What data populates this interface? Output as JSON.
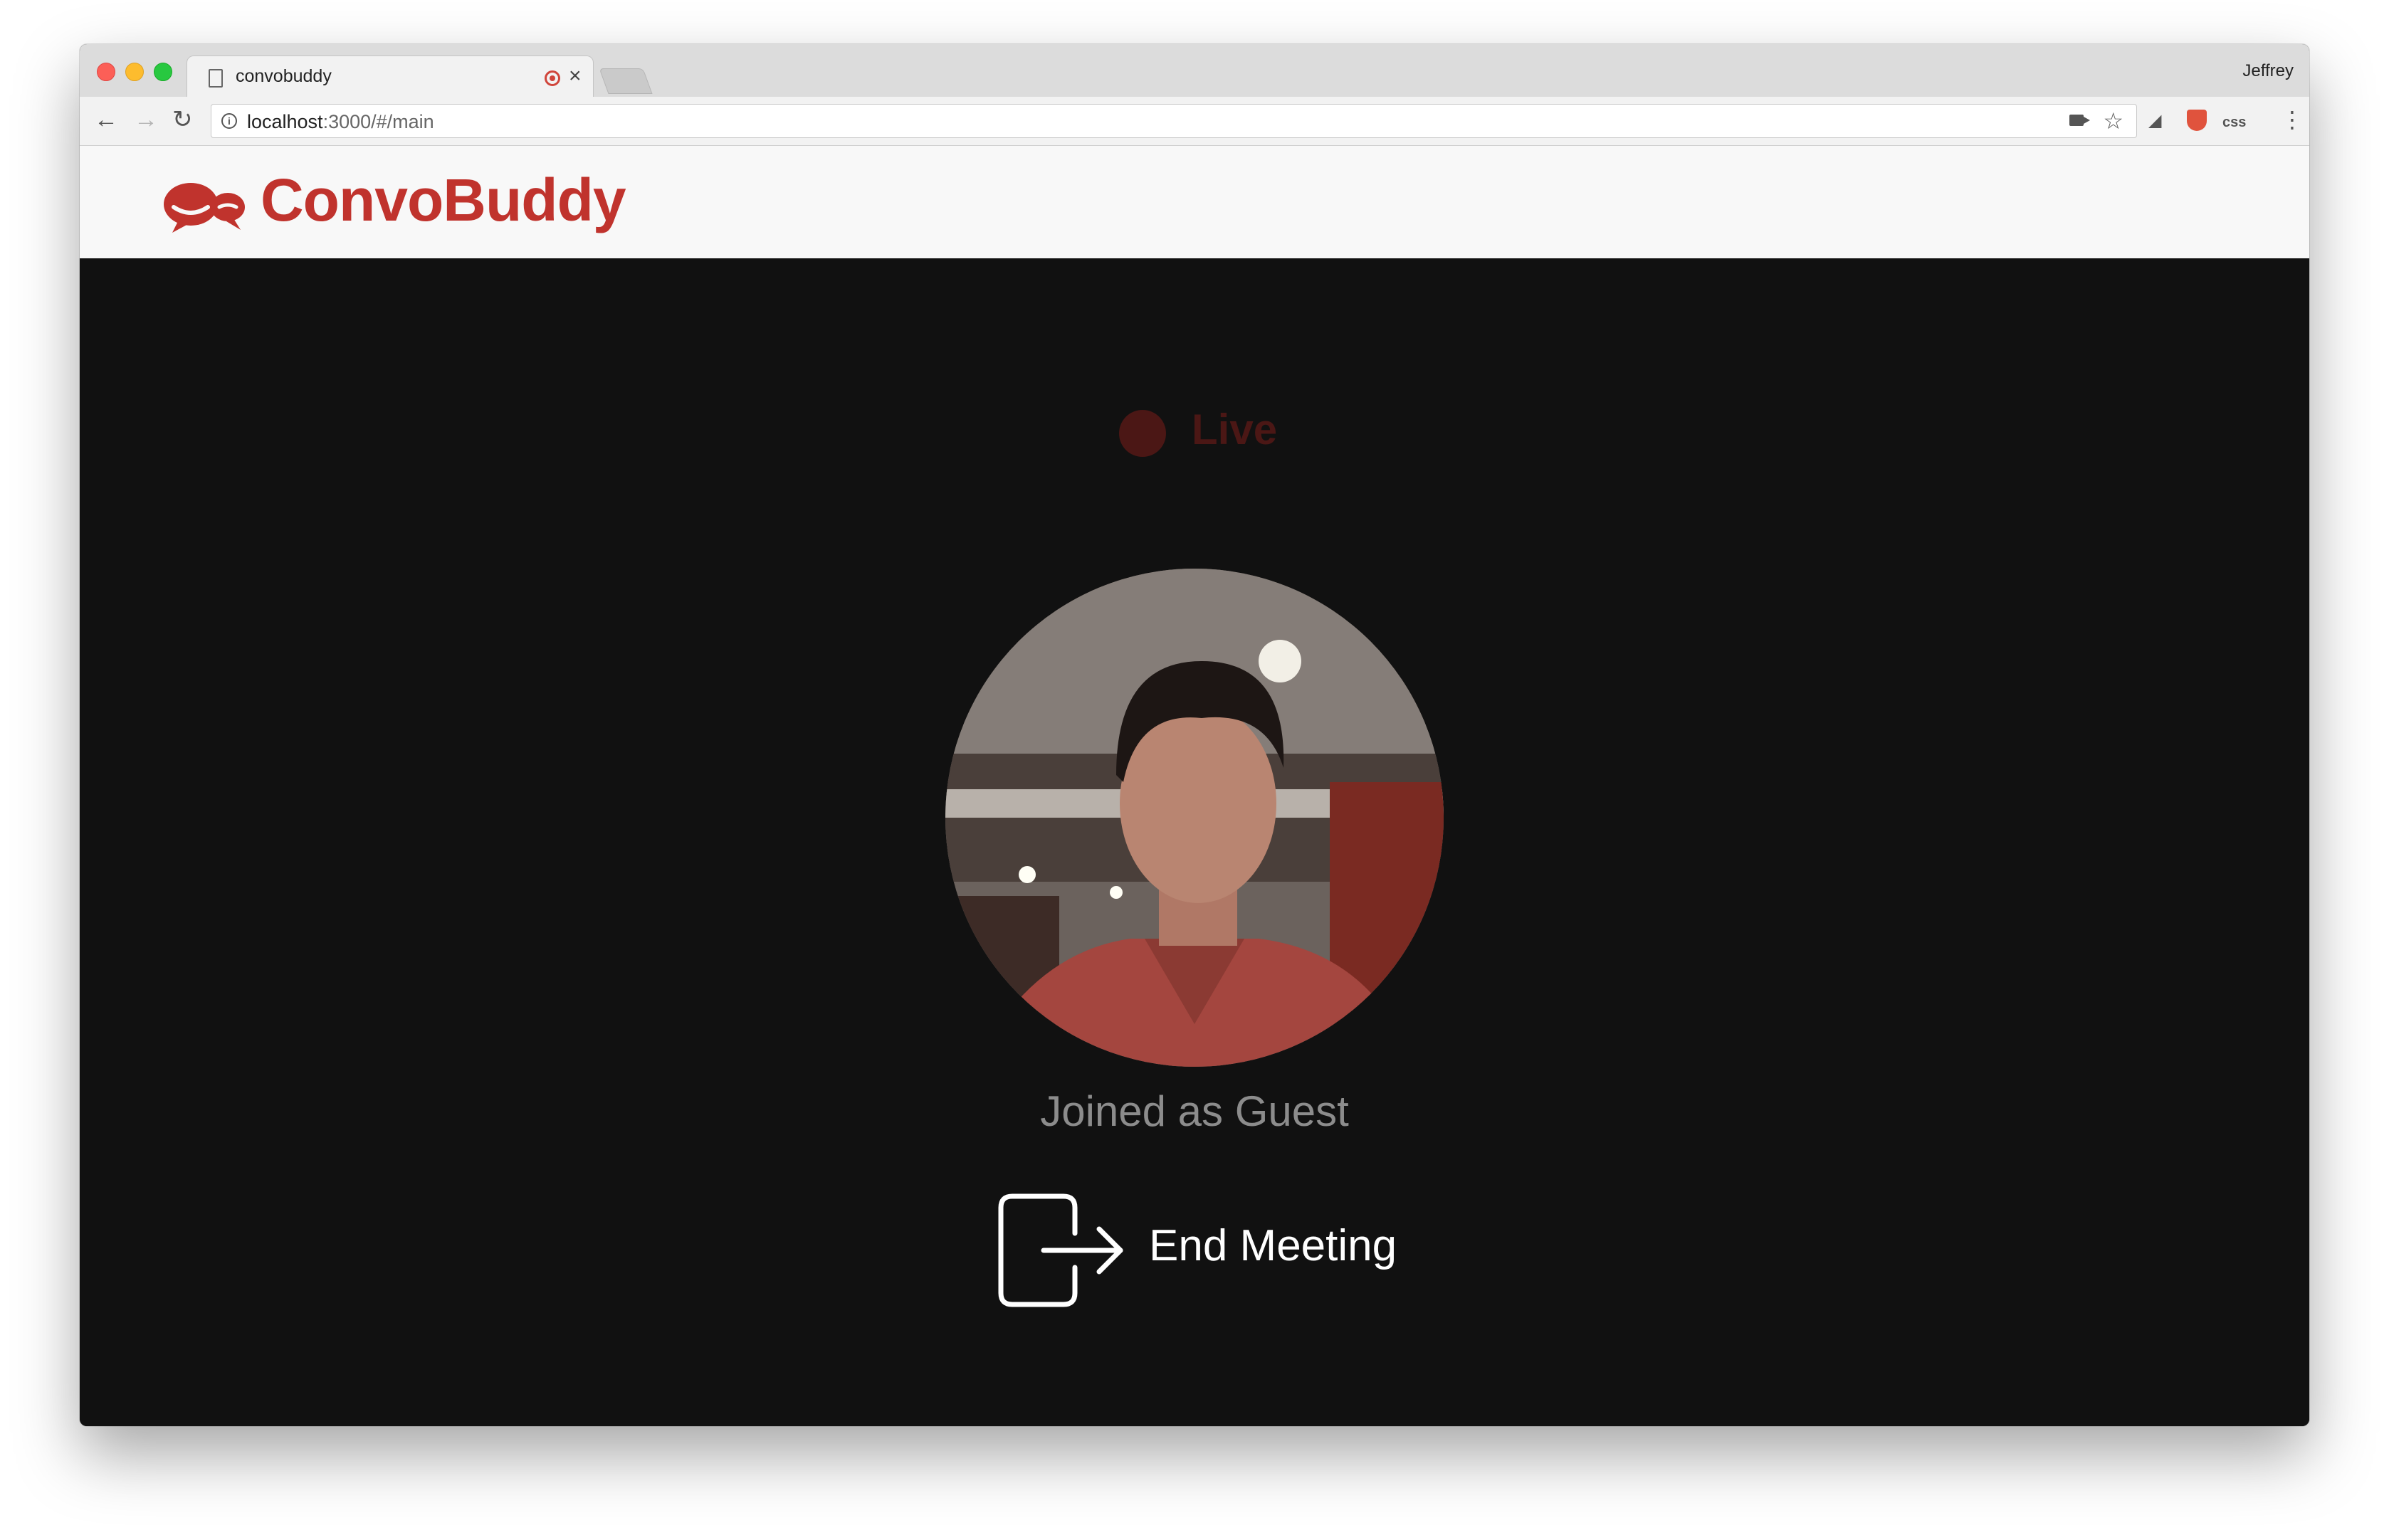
{
  "browser": {
    "tab_title": "convobuddy",
    "tab_close": "×",
    "profile_name": "Jeffrey",
    "url_host": "localhost",
    "url_path": ":3000/#/main",
    "ext_css_label": "css"
  },
  "app": {
    "brand_name": "ConvoBuddy",
    "brand_color": "#c0332d",
    "live_label": "Live",
    "live_color": "#4b1715",
    "status_text": "Joined as Guest",
    "end_meeting_label": "End Meeting",
    "background_color": "#111111"
  }
}
